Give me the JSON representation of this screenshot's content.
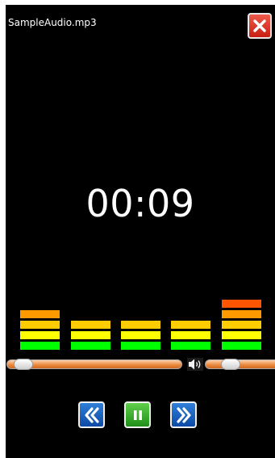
{
  "window": {
    "file_name": "SampleAudio.mp3"
  },
  "close_button": {
    "icon": "close-icon",
    "color": "#d9281c"
  },
  "playback": {
    "elapsed": "00:09",
    "progress_fraction": 0.04
  },
  "volume": {
    "icon": "speaker-icon",
    "level_fraction": 0.28
  },
  "equalizer": {
    "levels": [
      4,
      3,
      3,
      3,
      5
    ],
    "segment_colors": [
      "#00ff00",
      "#ffff00",
      "#ffcc00",
      "#ff9900",
      "#ff5500"
    ]
  },
  "controls": {
    "rewind": {
      "icon": "double-chevron-left-icon",
      "color": "#1b5fc0"
    },
    "pause": {
      "icon": "pause-icon",
      "color": "#3bb02f"
    },
    "fast_forward": {
      "icon": "double-chevron-right-icon",
      "color": "#1b5fc0"
    }
  }
}
